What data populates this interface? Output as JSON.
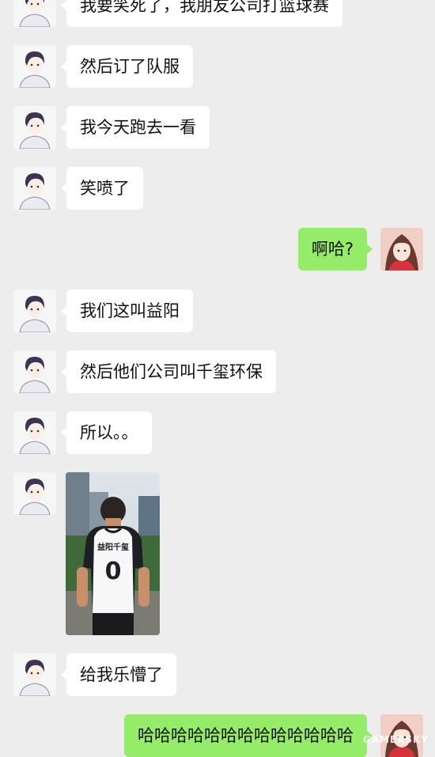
{
  "colors": {
    "background": "#ededed",
    "incoming_bubble": "#ffffff",
    "outgoing_bubble": "#95ec69"
  },
  "messages": [
    {
      "sender": "friend",
      "text": "我要笑死了，我朋友公司打篮球赛"
    },
    {
      "sender": "friend",
      "text": "然后订了队服"
    },
    {
      "sender": "friend",
      "text": "我今天跑去一看"
    },
    {
      "sender": "friend",
      "text": "笑喷了"
    },
    {
      "sender": "me",
      "text": "啊哈?"
    },
    {
      "sender": "friend",
      "text": "我们这叫益阳"
    },
    {
      "sender": "friend",
      "text": "然后他们公司叫千玺环保"
    },
    {
      "sender": "friend",
      "text": "所以。。"
    },
    {
      "sender": "friend",
      "type": "image",
      "jersey_text": "益阳千玺",
      "jersey_number": "0"
    },
    {
      "sender": "friend",
      "text": "给我乐懵了"
    },
    {
      "sender": "me",
      "text": "哈哈哈哈哈哈哈哈哈哈哈哈哈"
    }
  ],
  "watermark": "GAMERSKY"
}
